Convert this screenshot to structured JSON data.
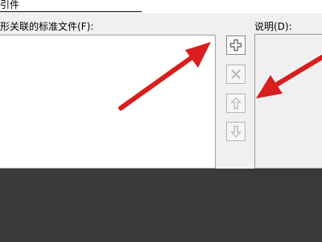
{
  "window": {
    "title_fragment": "引件"
  },
  "dialog": {
    "list_label": "形关联的标准文件(F):",
    "description_label": "说明(D):"
  },
  "toolbar": {
    "add_icon": "plus-icon",
    "remove_icon": "x-icon",
    "move_up_icon": "arrow-up-icon",
    "move_down_icon": "arrow-down-icon"
  },
  "annotation": {
    "arrow_color": "#d81e1e"
  },
  "colors": {
    "panel_bg": "#f0f0f0",
    "list_bg": "#ffffff",
    "bottom_panel": "#3a3a3a"
  }
}
